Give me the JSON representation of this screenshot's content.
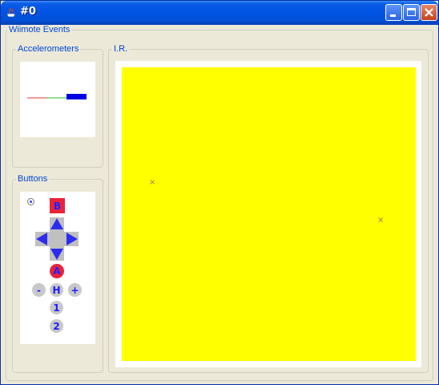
{
  "window": {
    "title": "#0",
    "colors": {
      "titlebar": "#0054e3",
      "face": "#ece9d8",
      "legend": "#0046d5"
    }
  },
  "group": {
    "label": "Wiimote Events"
  },
  "accelerometers": {
    "label": "Accelerometers",
    "bars": {
      "x_color": "#e03030",
      "y_color": "#2db82d",
      "z_color": "#0000e0"
    }
  },
  "buttons": {
    "label": "Buttons",
    "b": "B",
    "a": "A",
    "minus": "-",
    "home": "H",
    "plus": "+",
    "one": "1",
    "two": "2",
    "icons": {
      "up": "arrow-up",
      "down": "arrow-down",
      "left": "arrow-left",
      "right": "arrow-right"
    }
  },
  "ir": {
    "label": "I.R.",
    "background": "#ffff00",
    "points": [
      {
        "glyph": "×"
      },
      {
        "glyph": "×"
      }
    ]
  }
}
